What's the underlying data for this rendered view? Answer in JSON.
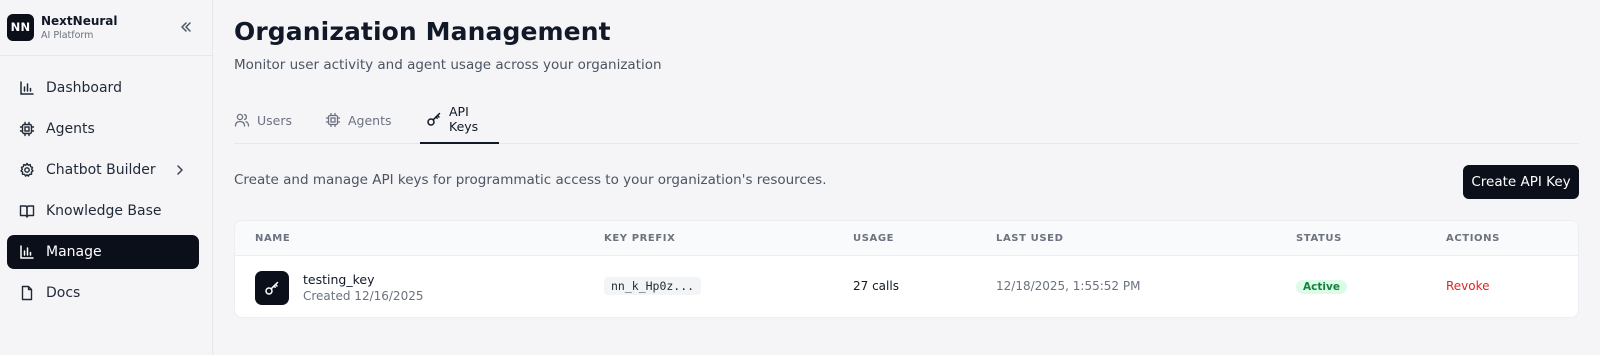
{
  "brand": {
    "logo_text": "NN",
    "name": "NextNeural",
    "subtitle": "AI Platform"
  },
  "sidebar": {
    "items": [
      {
        "label": "Dashboard",
        "icon": "bar-chart-icon",
        "active": false
      },
      {
        "label": "Agents",
        "icon": "cpu-icon",
        "active": false
      },
      {
        "label": "Chatbot Builder",
        "icon": "gear-icon",
        "active": false,
        "has_submenu": true
      },
      {
        "label": "Knowledge Base",
        "icon": "book-icon",
        "active": false
      },
      {
        "label": "Manage",
        "icon": "bar-chart-icon",
        "active": true
      },
      {
        "label": "Docs",
        "icon": "file-icon",
        "active": false
      }
    ]
  },
  "header": {
    "title": "Organization Management",
    "subtitle": "Monitor user activity and agent usage across your organization"
  },
  "tabs": [
    {
      "label": "Users",
      "icon": "users-icon",
      "active": false
    },
    {
      "label": "Agents",
      "icon": "cpu-icon",
      "active": false
    },
    {
      "label": "API Keys",
      "icon": "key-icon",
      "active": true
    }
  ],
  "api_keys": {
    "description": "Create and manage API keys for programmatic access to your organization's resources.",
    "create_button": "Create API Key",
    "columns": [
      "NAME",
      "KEY PREFIX",
      "USAGE",
      "LAST USED",
      "STATUS",
      "ACTIONS"
    ],
    "rows": [
      {
        "name": "testing_key",
        "created": "Created 12/16/2025",
        "prefix": "nn_k_Hp0z...",
        "usage": "27 calls",
        "last_used": "12/18/2025, 1:55:52 PM",
        "status": "Active",
        "action": "Revoke"
      }
    ]
  },
  "colors": {
    "primary_dark": "#0b0f19",
    "status_active_bg": "#dcfce7",
    "status_active_text": "#15803d",
    "danger": "#dc2626"
  }
}
